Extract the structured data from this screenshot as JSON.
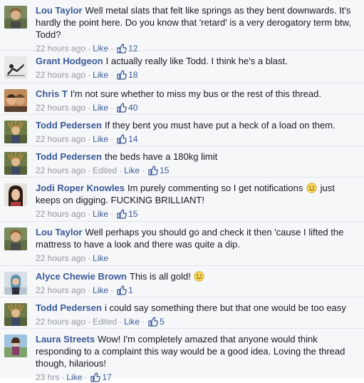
{
  "comments": [
    {
      "author": "Lou Taylor",
      "text": "Well metal slats that felt like springs as they bent downwards. It's hardly the point here. Do you know that 'retard' is a very derogatory term btw, Todd?",
      "time": "22 hours ago",
      "like": "Like",
      "likes": "12",
      "avatar": "lou"
    },
    {
      "author": "Grant Hodgeon",
      "text": "I actually really like Todd. I think he's a blast.",
      "time": "22 hours ago",
      "like": "Like",
      "likes": "18",
      "avatar": "grant"
    },
    {
      "author": "Chris T",
      "text": "I'm not sure whether to miss my bus or the rest of this thread.",
      "time": "22 hours ago",
      "like": "Like",
      "likes": "40",
      "avatar": "chris"
    },
    {
      "author": "Todd Pedersen",
      "text": "If they bent you must have put a heck of a load on them.",
      "time": "22 hours ago",
      "like": "Like",
      "likes": "14",
      "avatar": "todd"
    },
    {
      "author": "Todd Pedersen",
      "text": "the beds have a 180kg limit",
      "time": "22 hours ago",
      "edited": "Edited",
      "like": "Like",
      "likes": "15",
      "avatar": "todd"
    },
    {
      "author": "Jodi Roper Knowles",
      "text": "Im purely commenting so I get notifications",
      "text2": "just keeps on digging. FUCKING BRILLIANT!",
      "time": "22 hours ago",
      "like": "Like",
      "likes": "15",
      "avatar": "jodi"
    },
    {
      "author": "Lou Taylor",
      "text": "Well perhaps you should go and check it then 'cause I lifted the mattress to have a look and there was quite a dip.",
      "time": "22 hours ago",
      "like": "Like",
      "avatar": "lou"
    },
    {
      "author": "Alyce Chewie Brown",
      "text": "This is all gold!",
      "time": "22 hours ago",
      "like": "Like",
      "likes": "1",
      "avatar": "alyce"
    },
    {
      "author": "Todd Pedersen",
      "text": "i could say something there but that one would be too easy",
      "time": "22 hours ago",
      "edited": "Edited",
      "like": "Like",
      "likes": "5",
      "avatar": "todd"
    },
    {
      "author": "Laura Streets",
      "text": "Wow! I'm completely amazed that anyone would think responding to a complaint this way would be a good idea. Loving the thread though, hilarious!",
      "time": "23 hrs",
      "like": "Like",
      "likes": "17",
      "avatar": "laura"
    }
  ],
  "colors": {
    "link": "#3b5998",
    "text": "#141823",
    "meta": "#9197a3",
    "background": "#f6f7f9"
  },
  "icons": {
    "like": "thumbs-up-icon",
    "emoji": "smiley-icon"
  }
}
